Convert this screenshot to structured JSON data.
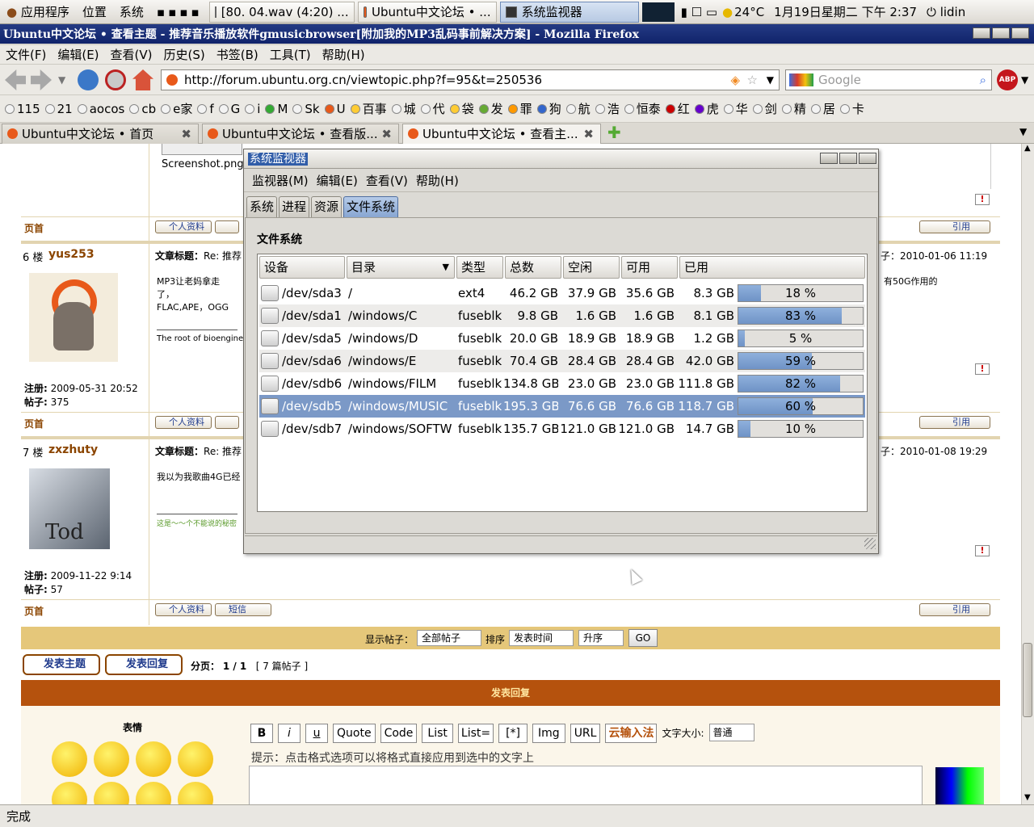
{
  "panel": {
    "apps": "应用程序",
    "places": "位置",
    "system": "系统",
    "tasks": [
      "[80. 04.wav (4:20) ...",
      "Ubuntu中文论坛 • ...",
      "系统监视器"
    ],
    "weather": "24°C",
    "clock": "1月19日星期二 下午 2:37",
    "user": "lidin"
  },
  "firefox": {
    "title": "Ubuntu中文论坛 • 查看主题 - 推荐音乐播放软件gmusicbrowser[附加我的MP3乱码事前解决方案] - Mozilla Firefox",
    "menu": [
      "文件(F)",
      "编辑(E)",
      "查看(V)",
      "历史(S)",
      "书签(B)",
      "工具(T)",
      "帮助(H)"
    ],
    "url": "http://forum.ubuntu.org.cn/viewtopic.php?f=95&t=250536",
    "search_placeholder": "Google",
    "bookmarks": [
      "115",
      "21",
      "aocos",
      "cb",
      "e家",
      "f",
      "G",
      "i",
      "M",
      "Sk",
      "U",
      "百事",
      "城",
      "代",
      "袋",
      "发",
      "罪",
      "狗",
      "航",
      "浩",
      "恒泰",
      "红",
      "虎",
      "华",
      "剑",
      "精",
      "居",
      "卡"
    ],
    "tabs": [
      "Ubuntu中文论坛 • 首页",
      "Ubuntu中文论坛 • 查看版...",
      "Ubuntu中文论坛 • 查看主..."
    ],
    "status": "完成"
  },
  "forum": {
    "screenshot_caption": "Screenshot.png",
    "page_top": "页首",
    "profile": "个人资料",
    "pm": "短信",
    "quote": "引用",
    "subject_label": "文章标题：",
    "subject_value": "Re: 推荐",
    "posts": [
      {
        "floor": "6 楼",
        "user": "yus253",
        "body1": "MP3让老妈拿走了，",
        "body2": "FLAC,APE，OGG",
        "sig": "The root of bioengine",
        "right": "有50G作用的",
        "date": "子：2010-01-06 11:19",
        "reg_label": "注册:",
        "reg": "2009-05-31 20:52",
        "posts_label": "帖子:",
        "count": "375"
      },
      {
        "floor": "7 楼",
        "user": "zxzhuty",
        "body1": "我以为我歌曲4G已经",
        "sig": "这是～～个不能说的秘密",
        "date": "子：2010-01-08 19:29",
        "reg_label": "注册:",
        "reg": "2009-11-22 9:14",
        "posts_label": "帖子:",
        "count": "57",
        "avatar_text": "Tod"
      }
    ],
    "display_label": "显示帖子：",
    "display_value": "全部帖子",
    "sort_label": "排序",
    "sort_value": "发表时间",
    "order_value": "升序",
    "go": "GO",
    "new_topic": "发表主题",
    "reply": "发表回复",
    "pagination_label": "分页：",
    "pagination": "1 / 1",
    "post_count": "[ 7 篇帖子 ]",
    "reply_header": "发表回复",
    "smileys_label": "表情",
    "format_buttons": [
      "B",
      "i",
      "u",
      "Quote",
      "Code",
      "List",
      "List=",
      "[*]",
      "Img",
      "URL",
      "云输入法"
    ],
    "font_size_label": "文字大小:",
    "font_size_value": "普通",
    "hint": "提示：点击格式选项可以将格式直接应用到选中的文字上"
  },
  "sysmon": {
    "title": "系统监视器",
    "menu": [
      "监视器(M)",
      "编辑(E)",
      "查看(V)",
      "帮助(H)"
    ],
    "tabs": [
      "系统",
      "进程",
      "资源",
      "文件系统"
    ],
    "section": "文件系统",
    "columns": [
      "设备",
      "目录",
      "类型",
      "总数",
      "空闲",
      "可用",
      "已用"
    ],
    "rows": [
      {
        "device": "/dev/sda3",
        "dir": "/",
        "type": "ext4",
        "total": "46.2 GB",
        "free": "37.9 GB",
        "avail": "35.6 GB",
        "used": "8.3 GB",
        "pct": "18 %",
        "frac": 0.18
      },
      {
        "device": "/dev/sda1",
        "dir": "/windows/C",
        "type": "fuseblk",
        "total": "9.8 GB",
        "free": "1.6 GB",
        "avail": "1.6 GB",
        "used": "8.1 GB",
        "pct": "83 %",
        "frac": 0.83
      },
      {
        "device": "/dev/sda5",
        "dir": "/windows/D",
        "type": "fuseblk",
        "total": "20.0 GB",
        "free": "18.9 GB",
        "avail": "18.9 GB",
        "used": "1.2 GB",
        "pct": "5 %",
        "frac": 0.05
      },
      {
        "device": "/dev/sda6",
        "dir": "/windows/E",
        "type": "fuseblk",
        "total": "70.4 GB",
        "free": "28.4 GB",
        "avail": "28.4 GB",
        "used": "42.0 GB",
        "pct": "59 %",
        "frac": 0.59
      },
      {
        "device": "/dev/sdb6",
        "dir": "/windows/FILM",
        "type": "fuseblk",
        "total": "134.8 GB",
        "free": "23.0 GB",
        "avail": "23.0 GB",
        "used": "111.8 GB",
        "pct": "82 %",
        "frac": 0.82
      },
      {
        "device": "/dev/sdb5",
        "dir": "/windows/MUSIC",
        "type": "fuseblk",
        "total": "195.3 GB",
        "free": "76.6 GB",
        "avail": "76.6 GB",
        "used": "118.7 GB",
        "pct": "60 %",
        "frac": 0.6
      },
      {
        "device": "/dev/sdb7",
        "dir": "/windows/SOFTW",
        "type": "fuseblk",
        "total": "135.7 GB",
        "free": "121.0 GB",
        "avail": "121.0 GB",
        "used": "14.7 GB",
        "pct": "10 %",
        "frac": 0.1
      }
    ]
  },
  "colors": {
    "accent": "#7b99c7",
    "forum_bar": "#e5c77a",
    "reply_bar": "#b5520d",
    "title_bar": "#1a2f78"
  }
}
